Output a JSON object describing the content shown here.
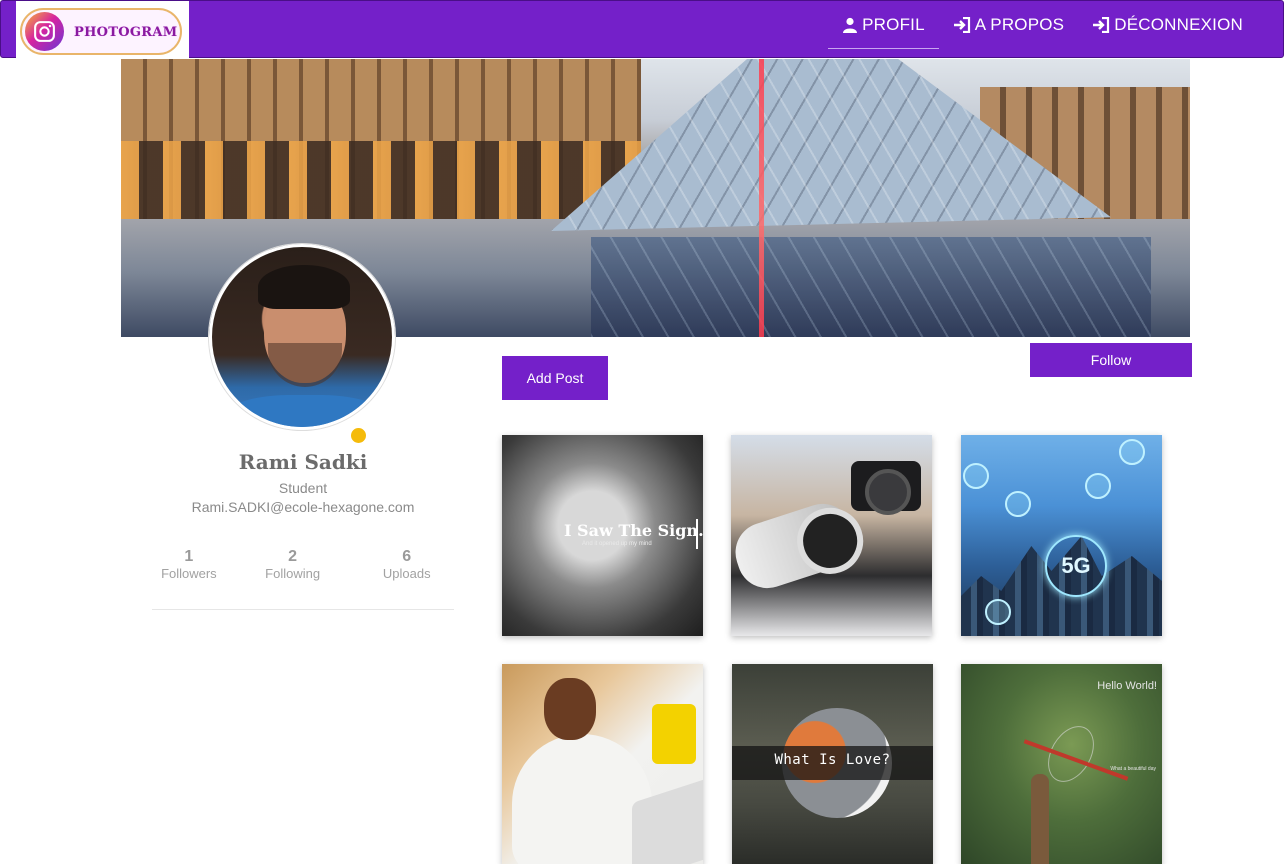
{
  "brand": {
    "logo_text": "PHOTOGRAM"
  },
  "nav": {
    "profil": "PROFIL",
    "apropos": "A PROPOS",
    "deconnexion": "DÉCONNEXION"
  },
  "profile": {
    "name": "Rami Sadki",
    "role": "Student",
    "email": "Rami.SADKI@ecole-hexagone.com",
    "stats": [
      {
        "value": "1",
        "label": "Followers"
      },
      {
        "value": "2",
        "label": "Following"
      },
      {
        "value": "6",
        "label": "Uploads"
      }
    ]
  },
  "actions": {
    "add_post": "Add Post",
    "follow": "Follow"
  },
  "posts": [
    {
      "title": "I Saw The Sign.",
      "subtitle": "And it opened up my mind"
    },
    {},
    {
      "badge": "5G"
    },
    {},
    {
      "caption": "What Is Love?"
    },
    {
      "caption": "Hello World!",
      "subcaption": "What a beautiful day"
    }
  ],
  "colors": {
    "brand": "#7420c9",
    "status": "#f5bb0b"
  }
}
